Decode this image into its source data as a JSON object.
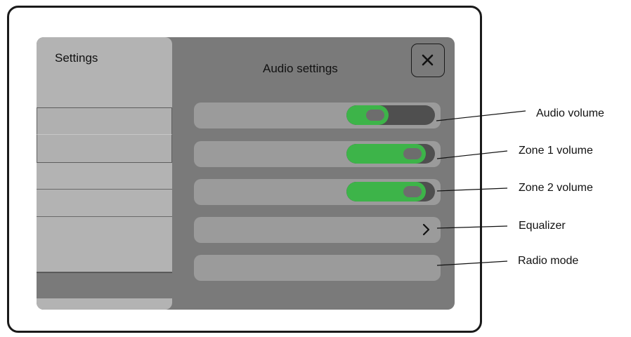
{
  "sidebar": {
    "title": "Settings"
  },
  "panel": {
    "title": "Audio settings"
  },
  "rows": [
    {
      "control": "toggle",
      "fill": 0.48,
      "callout": "Audio volume"
    },
    {
      "control": "toggle",
      "fill": 0.9,
      "callout": "Zone 1 volume"
    },
    {
      "control": "toggle",
      "fill": 0.9,
      "callout": "Zone 2 volume"
    },
    {
      "control": "chevron",
      "callout": "Equalizer"
    },
    {
      "control": "none",
      "callout": "Radio mode"
    }
  ],
  "colors": {
    "toggle_on": "#3db449",
    "toggle_off": "#4f4f4f",
    "screen_bg": "#7a7a7a",
    "sidebar_bg": "#b3b3b3"
  },
  "icons": {
    "close": "close-icon",
    "chevron": "chevron-right-icon"
  }
}
